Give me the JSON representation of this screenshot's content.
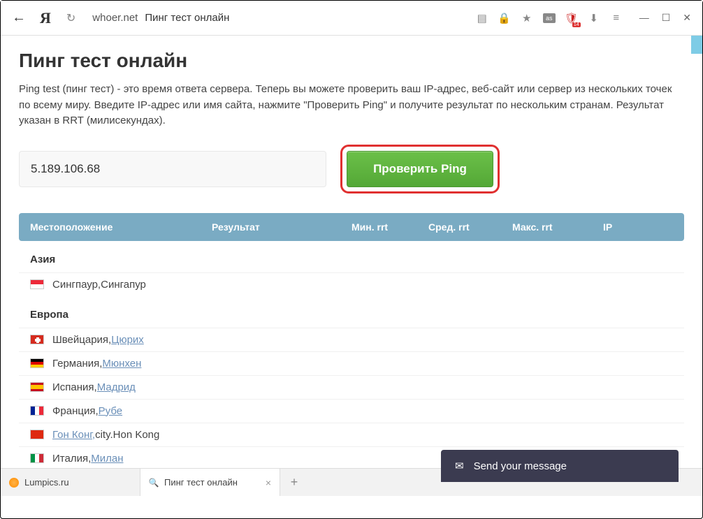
{
  "browser": {
    "domain": "whoer.net",
    "page_label": "Пинг тест онлайн",
    "shield_badge": "14"
  },
  "page": {
    "title": "Пинг тест онлайн",
    "description": "Ping test (пинг тест) - это время ответа сервера. Теперь вы можете проверить ваш IP-адрес, веб-сайт или сервер из нескольких точек по всему миру. Введите IP-адрес или имя сайта, нажмите \"Проверить Ping\" и получите результат по нескольким странам. Результат указан в RRT (милисекундах).",
    "ip_input_value": "5.189.106.68",
    "ping_button": "Проверить Ping"
  },
  "table": {
    "headers": {
      "location": "Местоположение",
      "result": "Результат",
      "min": "Мин. rrt",
      "avg": "Сред. rrt",
      "max": "Макс. rrt",
      "ip": "IP"
    }
  },
  "regions": {
    "asia": {
      "title": "Азия",
      "rows": [
        {
          "flag": "sg",
          "country": "Сингпаур, ",
          "city": "Сингапур",
          "city_link": false
        }
      ]
    },
    "europe": {
      "title": "Европа",
      "rows": [
        {
          "flag": "ch",
          "country": "Швейцария, ",
          "city": "Цюрих",
          "city_link": true
        },
        {
          "flag": "de",
          "country": "Германия, ",
          "city": "Мюнхен",
          "city_link": true
        },
        {
          "flag": "es",
          "country": "Испания, ",
          "city": "Мадрид",
          "city_link": true
        },
        {
          "flag": "fr",
          "country": "Франция, ",
          "city": "Рубе",
          "city_link": true
        },
        {
          "flag": "hk",
          "country": "Гон Конг, ",
          "city": "city.Hon Kong",
          "city_link": false,
          "country_link": true
        },
        {
          "flag": "it",
          "country": "Италия, ",
          "city": "Милан",
          "city_link": true
        }
      ]
    }
  },
  "chat": {
    "label": "Send your message"
  },
  "tabs": [
    {
      "favicon": "orange",
      "title": "Lumpics.ru",
      "active": false,
      "closable": false
    },
    {
      "favicon": "search",
      "title": "Пинг тест онлайн",
      "active": true,
      "closable": true
    }
  ]
}
